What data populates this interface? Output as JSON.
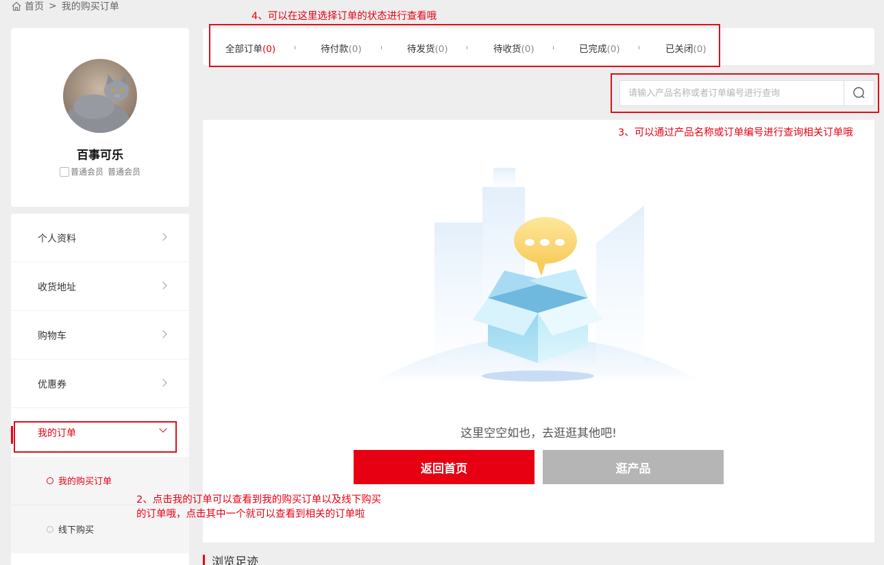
{
  "breadcrumb": {
    "home": "首页",
    "separator": ">",
    "current": "我的购买订单"
  },
  "annotations": {
    "tabs_note": "4、可以在这里选择订单的状态进行查看哦",
    "search_note": "3、可以通过产品名称或订单编号进行查询相关订单哦",
    "menu_note_line1": "2、点击我的订单可以查看到我的购买订单以及线下购买",
    "menu_note_line2": "的订单哦，点击其中一个就可以查看到相关的订单啦"
  },
  "profile": {
    "username": "百事可乐",
    "member_img_alt": "普通会员",
    "member_level": "普通会员"
  },
  "menu": {
    "items": [
      {
        "label": "个人资料"
      },
      {
        "label": "收货地址"
      },
      {
        "label": "购物车"
      },
      {
        "label": "优惠券"
      },
      {
        "label": "我的订单"
      }
    ],
    "submenu": [
      {
        "label": "我的购买订单"
      },
      {
        "label": "线下购买"
      }
    ]
  },
  "tabs": [
    {
      "label": "全部订单",
      "count": "(0)"
    },
    {
      "label": "待付款",
      "count": "(0)"
    },
    {
      "label": "待发货",
      "count": "(0)"
    },
    {
      "label": "待收货",
      "count": "(0)"
    },
    {
      "label": "已完成",
      "count": "(0)"
    },
    {
      "label": "已关闭",
      "count": "(0)"
    }
  ],
  "search": {
    "placeholder": "请输入产品名称或者订单编号进行查询"
  },
  "empty": {
    "message": "这里空空如也，去逛逛其他吧!",
    "home_button": "返回首页",
    "products_button": "逛产品"
  },
  "history": {
    "title": "浏览足迹"
  },
  "colors": {
    "accent": "#e60012",
    "annotation": "#e60012",
    "button_gray": "#b5b5b5"
  }
}
